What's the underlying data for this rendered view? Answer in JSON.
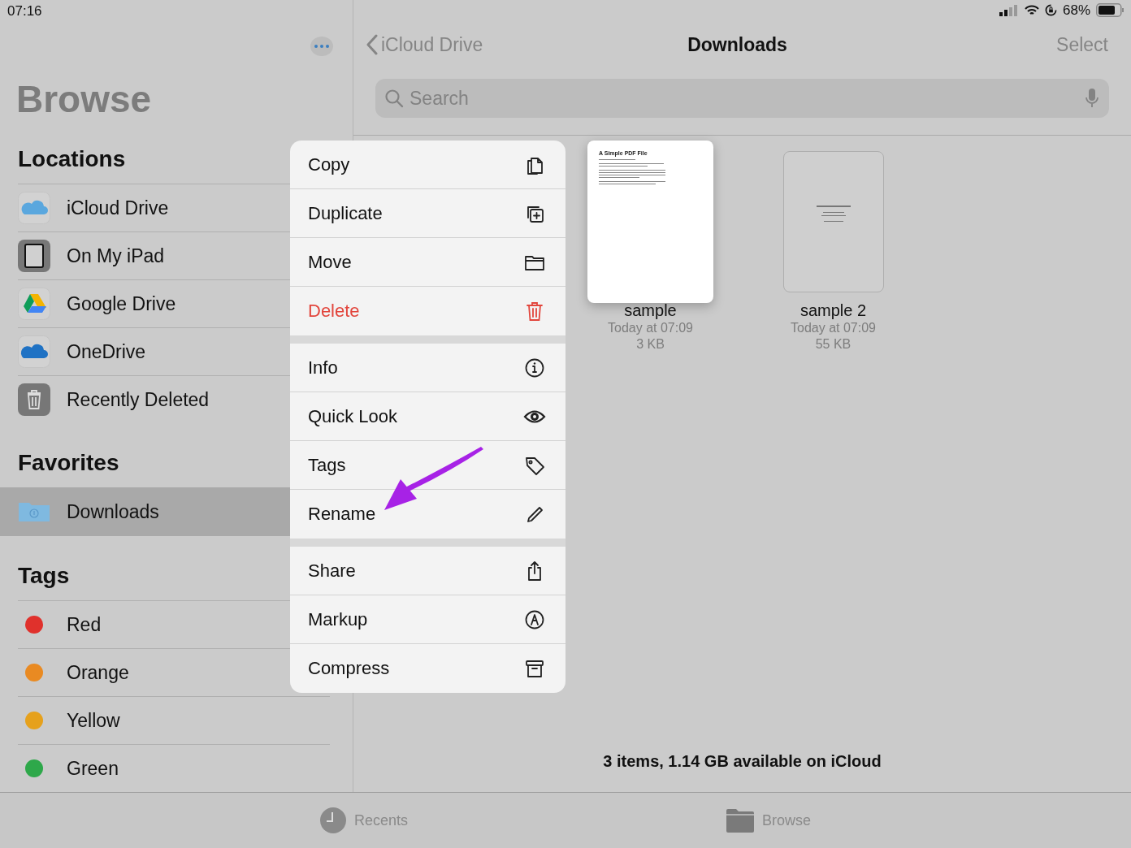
{
  "status_bar": {
    "time": "07:16",
    "battery": "68%"
  },
  "sidebar": {
    "title": "Browse",
    "sections": [
      {
        "kind": "locations",
        "heading": "Locations",
        "items": [
          {
            "label": "iCloud Drive",
            "selected": false
          },
          {
            "label": "On My iPad",
            "selected": false
          },
          {
            "label": "Google Drive",
            "selected": false
          },
          {
            "label": "OneDrive",
            "selected": false
          },
          {
            "label": "Recently Deleted",
            "selected": false
          }
        ]
      },
      {
        "kind": "favorites",
        "heading": "Favorites",
        "items": [
          {
            "label": "Downloads",
            "selected": true
          }
        ]
      },
      {
        "kind": "tags",
        "heading": "Tags",
        "items": [
          {
            "label": "Red",
            "selected": false,
            "color": "#e0312c"
          },
          {
            "label": "Orange",
            "selected": false,
            "color": "#e98a22"
          },
          {
            "label": "Yellow",
            "selected": false,
            "color": "#e6a11c"
          },
          {
            "label": "Green",
            "selected": false,
            "color": "#2ea84a"
          }
        ]
      }
    ]
  },
  "navigation": {
    "back": "iCloud Drive",
    "title": "Downloads",
    "action": "Select"
  },
  "search": {
    "placeholder": "Search"
  },
  "files": [
    {
      "name": "sample",
      "date": "Today at 07:09",
      "size": "3 KB",
      "selected": true,
      "preview_title": "A Simple PDF File"
    },
    {
      "name": "sample 2",
      "date": "Today at 07:09",
      "size": "55 KB",
      "selected": false
    }
  ],
  "footer": "3 items, 1.14 GB available on iCloud",
  "context_menu": {
    "groups": [
      [
        {
          "label": "Copy",
          "destructive": false
        },
        {
          "label": "Duplicate",
          "destructive": false
        },
        {
          "label": "Move",
          "destructive": false
        },
        {
          "label": "Delete",
          "destructive": true
        }
      ],
      [
        {
          "label": "Info",
          "destructive": false
        },
        {
          "label": "Quick Look",
          "destructive": false
        },
        {
          "label": "Tags",
          "destructive": false
        },
        {
          "label": "Rename",
          "destructive": false
        }
      ],
      [
        {
          "label": "Share",
          "destructive": false
        },
        {
          "label": "Markup",
          "destructive": false
        },
        {
          "label": "Compress",
          "destructive": false
        }
      ]
    ]
  },
  "tab_bar": [
    {
      "label": "Recents",
      "selected": false
    },
    {
      "label": "Browse",
      "selected": false
    }
  ]
}
